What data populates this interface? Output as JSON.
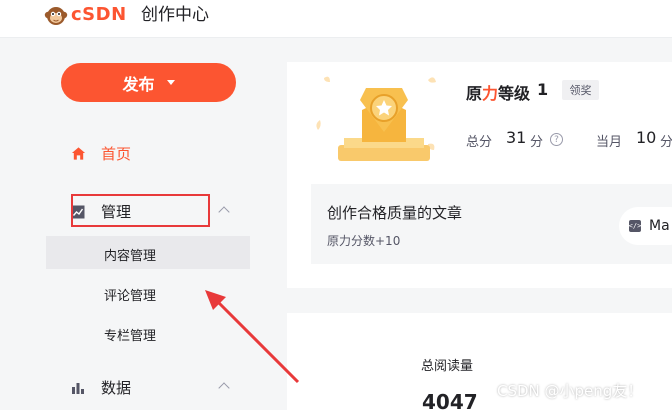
{
  "header": {
    "logo_text": "CSDN",
    "title": "创作中心"
  },
  "sidebar": {
    "publish_label": "发布",
    "items": [
      {
        "label": "首页",
        "icon": "home-icon",
        "active": true
      },
      {
        "label": "管理",
        "icon": "chart-line-icon",
        "expanded": true,
        "children": [
          {
            "label": "内容管理",
            "selected": true
          },
          {
            "label": "评论管理"
          },
          {
            "label": "专栏管理"
          }
        ]
      },
      {
        "label": "数据",
        "icon": "bar-chart-icon",
        "expanded": true
      }
    ]
  },
  "profile": {
    "level_title_a": "原",
    "level_title_b": "力",
    "level_title_c": "等级",
    "level_num": "1",
    "claim_label": "领奖",
    "total_label": "总分",
    "total_value": "31",
    "total_unit": "分",
    "month_label": "当月",
    "month_value": "10",
    "month_unit": "分"
  },
  "task": {
    "title": "创作合格质量的文章",
    "subtitle": "原力分数+10",
    "button_label": "Ma"
  },
  "stats": {
    "read_label": "总阅读量",
    "read_value": "4047"
  },
  "watermark": "CSDN @小peng友！",
  "colors": {
    "brand": "#fc5531",
    "annotation": "#e8393a"
  }
}
